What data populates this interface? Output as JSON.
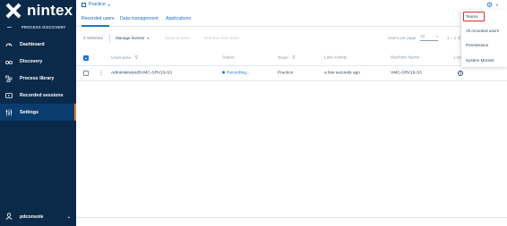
{
  "brand": {
    "name": "nintex"
  },
  "sidebar": {
    "section_label": "PROCESS DISCOVERY",
    "items": [
      {
        "label": "Dashboard",
        "icon": "gauge-icon"
      },
      {
        "label": "Discovery",
        "icon": "binoculars-icon"
      },
      {
        "label": "Process library",
        "icon": "library-icon"
      },
      {
        "label": "Recorded sessions",
        "icon": "video-icon"
      },
      {
        "label": "Settings",
        "icon": "settings-icon",
        "active": true
      }
    ],
    "user": {
      "name": "pdconsole",
      "chevron": "⌄"
    }
  },
  "topbar": {
    "project_label": "Practice",
    "project_caret": "▾",
    "gear": "⚙",
    "gear_caret": "▾"
  },
  "tabs": [
    {
      "label": "Recorded users",
      "active": true
    },
    {
      "label": "Data management"
    },
    {
      "label": "Applications"
    }
  ],
  "toolbar": {
    "selected": "0 Selected",
    "manage_license": "Manage license",
    "manage_license_caret": "▾",
    "move_to_team": "Move to team",
    "remove_from_team": "Remove from team",
    "users_per_page_label": "Users per page",
    "users_per_page_value": "10",
    "users_per_page_caret": "▾",
    "range": "1 – 1 of"
  },
  "table": {
    "headers": {
      "username": "Username",
      "status": "Status",
      "team": "Team",
      "last_activity": "Last Activity",
      "machine": "Machine Name",
      "license": "Licen"
    },
    "filter_glyph": "⊽",
    "rows": [
      {
        "menu": "⋮",
        "username": "Administrator@VMC-SRV19-S3",
        "status": "Recording...",
        "team": "Practice",
        "last_activity": "a few seconds ago",
        "machine": "VMC-SRV19-S3",
        "license_glyph": "$"
      }
    ]
  },
  "settings_menu": {
    "items": [
      "Teams",
      "All recorded users",
      "Permissions",
      "System Monitor"
    ],
    "highlighted": "Teams"
  },
  "colors": {
    "sidebar_bg": "#0b2a4a",
    "accent": "#1976d2",
    "active_marker": "#f47b20",
    "highlight": "#d93025"
  }
}
